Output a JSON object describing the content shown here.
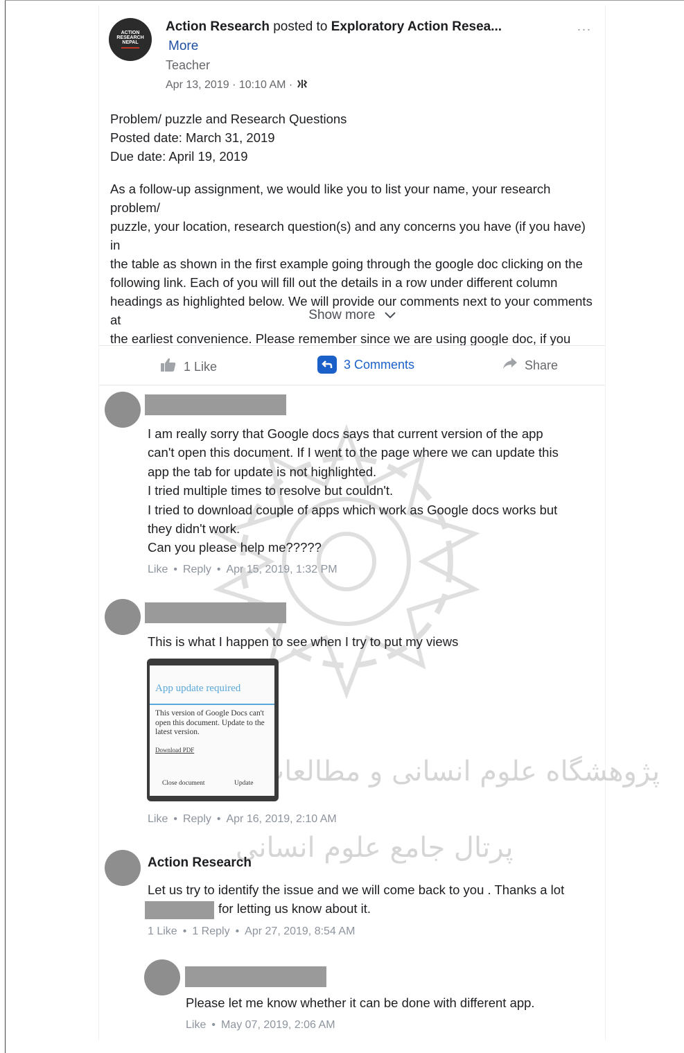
{
  "post": {
    "author": "Action Research",
    "posted_to_word": "posted to",
    "group": "Exploratory Action Resea...",
    "more_link": "More",
    "role": "Teacher",
    "date": "Apr 13, 2019 · 10:10 AM ·",
    "logo_text": [
      "ACTION",
      "RESEARCH",
      "NEPAL"
    ],
    "options": "...",
    "lines_header": [
      "Problem/ puzzle and Research Questions",
      "Posted date: March 31, 2019",
      "Due date: April 19, 2019"
    ],
    "body_lines": [
      "As a follow-up assignment, we would like you to list your name, your research problem/",
      "puzzle, your location, research question(s) and any concerns you have (if you have) in",
      "the table as shown in the first example going through the google doc clicking on the",
      "following link. Each of you will fill out the details in a row under different column",
      "headings as highlighted below. We will provide our comments next to your comments at",
      "the earliest convenience. Please remember since we are using google doc, if you"
    ],
    "show_more": "Show more"
  },
  "actions": {
    "like": "1 Like",
    "comments": "3 Comments",
    "share": "Share"
  },
  "comments": [
    {
      "lines": [
        "I am really sorry that Google docs says that current version of the app",
        "can't open this document. If I went to the page where we can update this",
        "app the tab for update is not highlighted.",
        "I tried multiple times to resolve but couldn't.",
        "I tried to download couple of apps which work as Google docs works but",
        "they didn't work.",
        "Can you please help me?????"
      ],
      "meta": {
        "like": "Like",
        "reply": "Reply",
        "date": "Apr 15, 2019, 1:32 PM"
      }
    },
    {
      "lines": [
        "This is what I happen to see when I try to put my views"
      ],
      "meta": {
        "like": "Like",
        "reply": "Reply",
        "date": "Apr 16, 2019, 2:10 AM"
      },
      "screenshot": {
        "title": "App update required",
        "body": "This version of Google Docs can't open this document. Update to the latest version.",
        "link": "Download PDF",
        "btn_close": "Close document",
        "btn_update": "Update"
      }
    },
    {
      "name": "Action Research",
      "lines": [
        "Let us try to identify the issue and we will come back to you . Thanks a lot",
        "for letting us know about it."
      ],
      "meta": {
        "like": "1 Like",
        "reply": "1 Reply",
        "date": "Apr 27, 2019, 8:54 AM"
      }
    },
    {
      "lines": [
        "Please let me know whether it can be done with different app."
      ],
      "meta": {
        "like": "Like",
        "date": "May 07, 2019, 2:06 AM"
      }
    }
  ],
  "watermark": {
    "line1": "پژوهشگاه علوم انسانی و مطالعات فرهنگی",
    "line2": "پرتال جامع علوم انسانی"
  }
}
